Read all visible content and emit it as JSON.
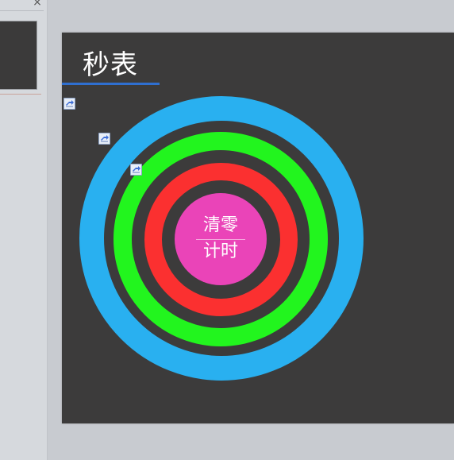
{
  "slide": {
    "title": "秒表",
    "center_button": {
      "top_label": "清零",
      "bottom_label": "计时"
    }
  },
  "colors": {
    "slide_background": "#3c3b3b",
    "outer_ring": "#29b0f0",
    "middle_ring": "#22f51e",
    "inner_ring": "#fb3030",
    "center_button": "#ea44b8",
    "title_underline": "#2f6fd0"
  },
  "icons": {
    "close": "close-icon",
    "animation_marker": "animation-trigger-icon"
  },
  "thumbnail_pane": {
    "close_glyph": "×"
  }
}
